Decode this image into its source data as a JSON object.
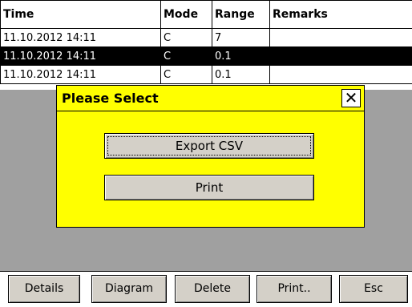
{
  "table": {
    "columns": [
      "Time",
      "Mode",
      "Range",
      "Remarks"
    ],
    "rows": [
      {
        "time": "11.10.2012 14:11",
        "mode": "C",
        "range": "7",
        "remarks": ""
      },
      {
        "time": "11.10.2012 14:11",
        "mode": "C",
        "range": "0.1",
        "remarks": "",
        "selected": true
      },
      {
        "time": "11.10.2012 14:11",
        "mode": "C",
        "range": "0.1",
        "remarks": ""
      }
    ]
  },
  "dialog": {
    "title": "Please Select",
    "close_icon": "✕",
    "export_label": "Export CSV",
    "print_label": "Print"
  },
  "toolbar": {
    "details": "Details",
    "diagram": "Diagram",
    "delete": "Delete",
    "print": "Print..",
    "esc": "Esc"
  },
  "colors": {
    "dialog_bg": "#ffff00",
    "selected_row_bg": "#000000",
    "button_face": "#d4d0c8",
    "overlay_gray": "#a0a0a0"
  }
}
